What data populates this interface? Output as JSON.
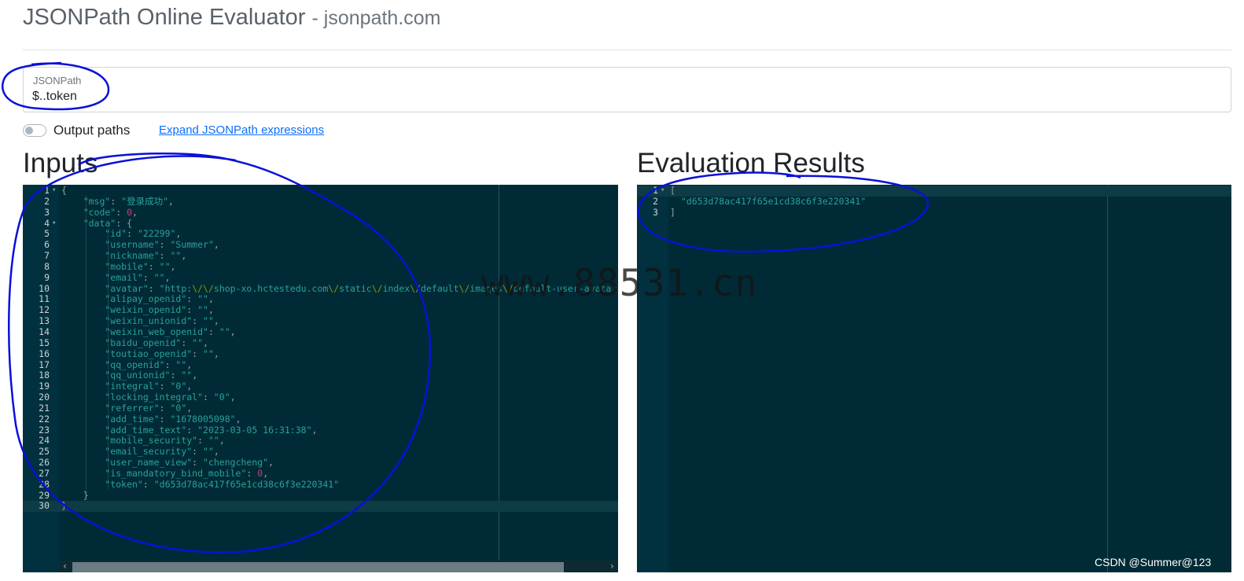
{
  "header": {
    "title": "JSONPath Online Evaluator",
    "subtitle": "- jsonpath.com"
  },
  "jsonpath": {
    "label": "JSONPath",
    "value": "$..token"
  },
  "options": {
    "output_paths_label": "Output paths",
    "output_paths_on": false,
    "expand_link": "Expand JSONPath expressions"
  },
  "inputs": {
    "heading": "Inputs",
    "lines": [
      [
        [
          "p",
          "{"
        ]
      ],
      [
        [
          "k",
          "    \"msg\""
        ],
        [
          "p",
          ": "
        ],
        [
          "s",
          "\"登录成功\""
        ],
        [
          "p",
          ","
        ]
      ],
      [
        [
          "k",
          "    \"code\""
        ],
        [
          "p",
          ": "
        ],
        [
          "n",
          "0"
        ],
        [
          "p",
          ","
        ]
      ],
      [
        [
          "k",
          "    \"data\""
        ],
        [
          "p",
          ": {"
        ]
      ],
      [
        [
          "k",
          "        \"id\""
        ],
        [
          "p",
          ": "
        ],
        [
          "s",
          "\"22299\""
        ],
        [
          "p",
          ","
        ]
      ],
      [
        [
          "k",
          "        \"username\""
        ],
        [
          "p",
          ": "
        ],
        [
          "s",
          "\"Summer\""
        ],
        [
          "p",
          ","
        ]
      ],
      [
        [
          "k",
          "        \"nickname\""
        ],
        [
          "p",
          ": "
        ],
        [
          "s",
          "\"\""
        ],
        [
          "p",
          ","
        ]
      ],
      [
        [
          "k",
          "        \"mobile\""
        ],
        [
          "p",
          ": "
        ],
        [
          "s",
          "\"\""
        ],
        [
          "p",
          ","
        ]
      ],
      [
        [
          "k",
          "        \"email\""
        ],
        [
          "p",
          ": "
        ],
        [
          "s",
          "\"\""
        ],
        [
          "p",
          ","
        ]
      ],
      [
        [
          "k",
          "        \"avatar\""
        ],
        [
          "p",
          ": "
        ],
        [
          "s",
          "\"http:"
        ],
        [
          "e",
          "\\/\\/"
        ],
        [
          "s",
          "shop-xo.hctestedu.com"
        ],
        [
          "e",
          "\\/"
        ],
        [
          "s",
          "static"
        ],
        [
          "e",
          "\\/"
        ],
        [
          "s",
          "index"
        ],
        [
          "e",
          "\\/"
        ],
        [
          "s",
          "default"
        ],
        [
          "e",
          "\\/"
        ],
        [
          "s",
          "images"
        ],
        [
          "e",
          "\\/"
        ],
        [
          "s",
          "default-user-avatar"
        ]
      ],
      [
        [
          "k",
          "        \"alipay_openid\""
        ],
        [
          "p",
          ": "
        ],
        [
          "s",
          "\"\""
        ],
        [
          "p",
          ","
        ]
      ],
      [
        [
          "k",
          "        \"weixin_openid\""
        ],
        [
          "p",
          ": "
        ],
        [
          "s",
          "\"\""
        ],
        [
          "p",
          ","
        ]
      ],
      [
        [
          "k",
          "        \"weixin_unionid\""
        ],
        [
          "p",
          ": "
        ],
        [
          "s",
          "\"\""
        ],
        [
          "p",
          ","
        ]
      ],
      [
        [
          "k",
          "        \"weixin_web_openid\""
        ],
        [
          "p",
          ": "
        ],
        [
          "s",
          "\"\""
        ],
        [
          "p",
          ","
        ]
      ],
      [
        [
          "k",
          "        \"baidu_openid\""
        ],
        [
          "p",
          ": "
        ],
        [
          "s",
          "\"\""
        ],
        [
          "p",
          ","
        ]
      ],
      [
        [
          "k",
          "        \"toutiao_openid\""
        ],
        [
          "p",
          ": "
        ],
        [
          "s",
          "\"\""
        ],
        [
          "p",
          ","
        ]
      ],
      [
        [
          "k",
          "        \"qq_openid\""
        ],
        [
          "p",
          ": "
        ],
        [
          "s",
          "\"\""
        ],
        [
          "p",
          ","
        ]
      ],
      [
        [
          "k",
          "        \"qq_unionid\""
        ],
        [
          "p",
          ": "
        ],
        [
          "s",
          "\"\""
        ],
        [
          "p",
          ","
        ]
      ],
      [
        [
          "k",
          "        \"integral\""
        ],
        [
          "p",
          ": "
        ],
        [
          "s",
          "\"0\""
        ],
        [
          "p",
          ","
        ]
      ],
      [
        [
          "k",
          "        \"locking_integral\""
        ],
        [
          "p",
          ": "
        ],
        [
          "s",
          "\"0\""
        ],
        [
          "p",
          ","
        ]
      ],
      [
        [
          "k",
          "        \"referrer\""
        ],
        [
          "p",
          ": "
        ],
        [
          "s",
          "\"0\""
        ],
        [
          "p",
          ","
        ]
      ],
      [
        [
          "k",
          "        \"add_time\""
        ],
        [
          "p",
          ": "
        ],
        [
          "s",
          "\"1678005098\""
        ],
        [
          "p",
          ","
        ]
      ],
      [
        [
          "k",
          "        \"add_time_text\""
        ],
        [
          "p",
          ": "
        ],
        [
          "s",
          "\"2023-03-05 16:31:38\""
        ],
        [
          "p",
          ","
        ]
      ],
      [
        [
          "k",
          "        \"mobile_security\""
        ],
        [
          "p",
          ": "
        ],
        [
          "s",
          "\"\""
        ],
        [
          "p",
          ","
        ]
      ],
      [
        [
          "k",
          "        \"email_security\""
        ],
        [
          "p",
          ": "
        ],
        [
          "s",
          "\"\""
        ],
        [
          "p",
          ","
        ]
      ],
      [
        [
          "k",
          "        \"user_name_view\""
        ],
        [
          "p",
          ": "
        ],
        [
          "s",
          "\"chengcheng\""
        ],
        [
          "p",
          ","
        ]
      ],
      [
        [
          "k",
          "        \"is_mandatory_bind_mobile\""
        ],
        [
          "p",
          ": "
        ],
        [
          "n",
          "0"
        ],
        [
          "p",
          ","
        ]
      ],
      [
        [
          "k",
          "        \"token\""
        ],
        [
          "p",
          ": "
        ],
        [
          "s",
          "\"d653d78ac417f65e1cd38c6f3e220341\""
        ]
      ],
      [
        [
          "p",
          "    }"
        ]
      ],
      [
        [
          "p",
          "}"
        ]
      ]
    ]
  },
  "results": {
    "heading": "Evaluation Results",
    "lines": [
      [
        [
          "p",
          "["
        ]
      ],
      [
        [
          "s",
          "  \"d653d78ac417f65e1cd38c6f3e220341\""
        ]
      ],
      [
        [
          "p",
          "]"
        ]
      ]
    ]
  },
  "watermark": "www.88531.cn",
  "credit": "CSDN @Summer@123",
  "colors": {
    "editor_bg": "#002b36",
    "string": "#2aa198",
    "number": "#d33682",
    "escape": "#859900",
    "annotation_ink": "#0a10d8",
    "link": "#0d6efd"
  }
}
